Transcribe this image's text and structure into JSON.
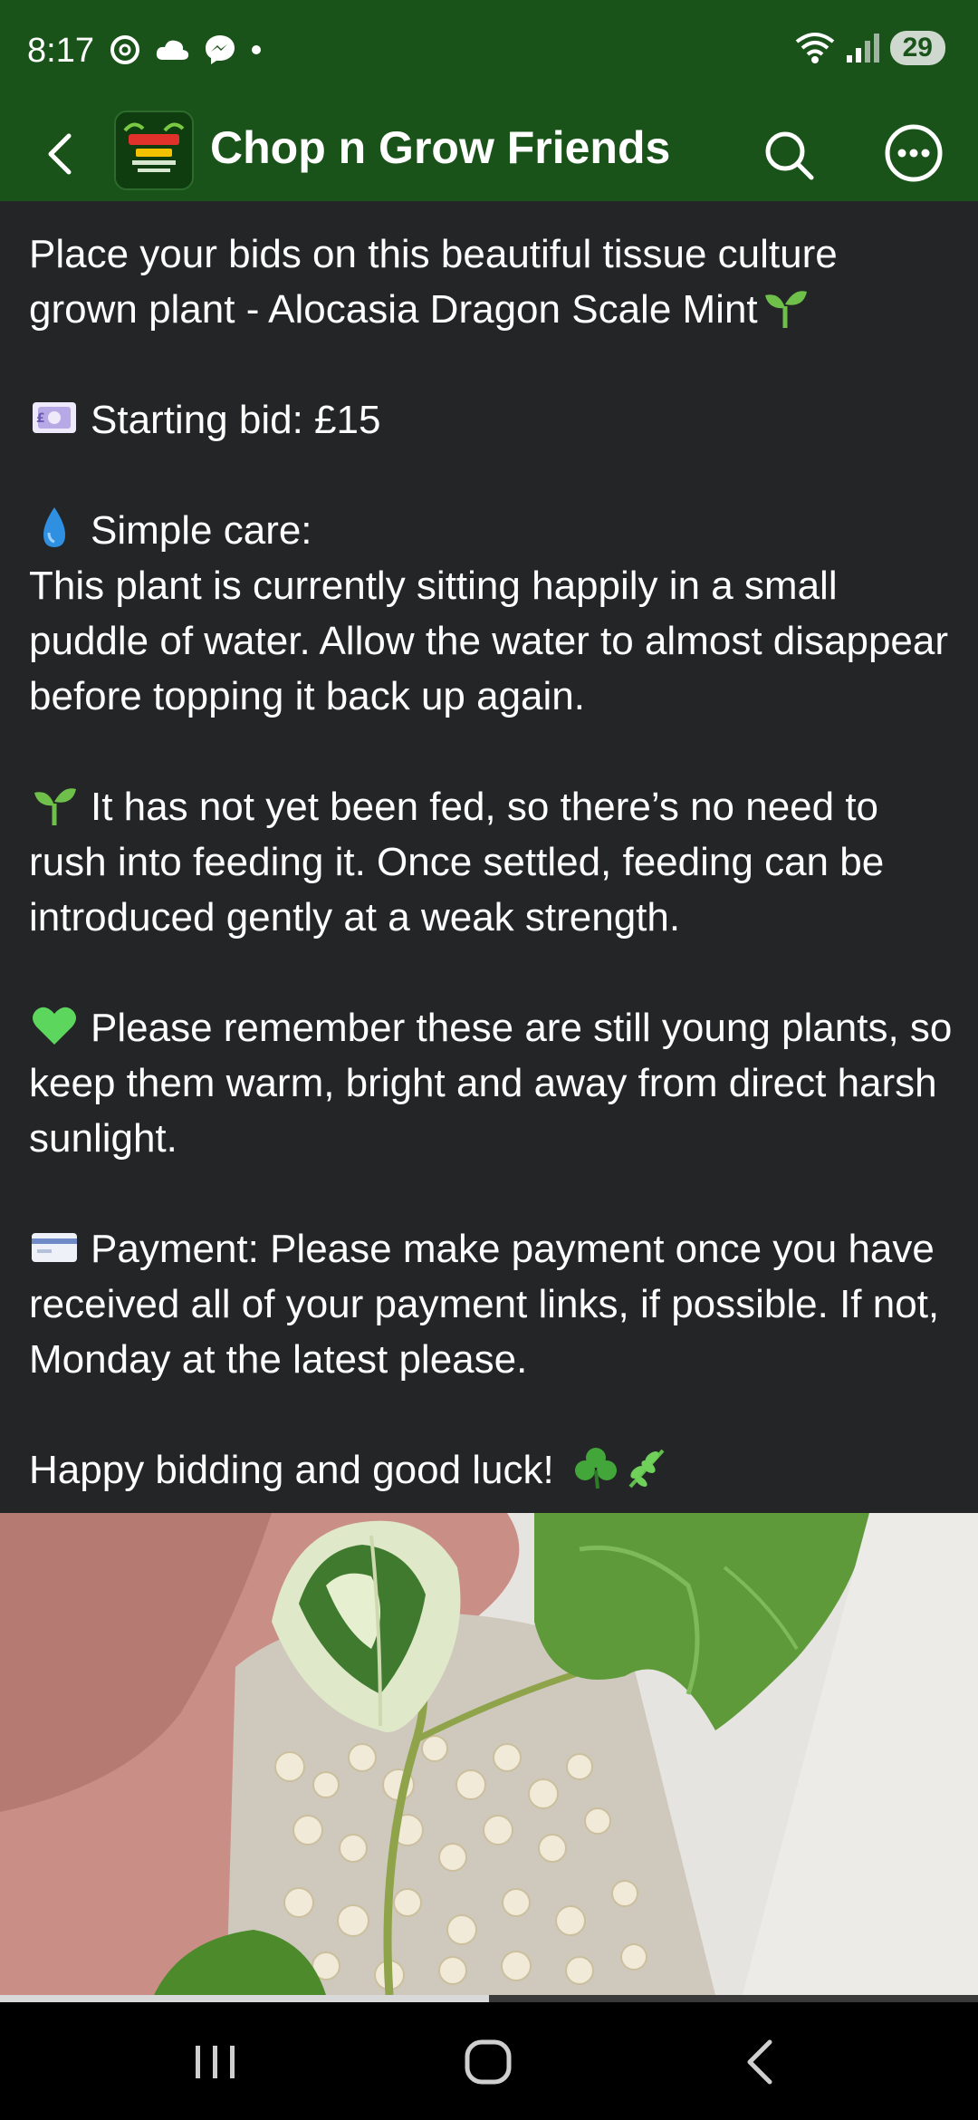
{
  "status_bar": {
    "time": "8:17",
    "battery": "29"
  },
  "app_bar": {
    "title": "Chop n Grow Friends",
    "avatar_text": "Chop n Grow Friends"
  },
  "post": {
    "intro": "Place your bids on this beautiful tissue culture grown plant - Alocasia Dragon Scale Mint",
    "starting_bid": "Starting bid: £15",
    "care_heading": "Simple care:",
    "care_text": "This plant is currently sitting happily in a small puddle of water. Allow the water to almost disappear before topping it back up again.",
    "feeding": "It has not yet been fed, so there’s no need to rush into feeding it. Once settled, feeding can be introduced gently at a weak strength.",
    "reminder": "Please remember these are still young plants, so keep them warm, bright and away from direct harsh sunlight.",
    "payment": "Payment: Please make payment once you have received all of your payment links, if possible. If not, Monday at the latest please.",
    "closing": "Happy bidding and good luck!"
  },
  "media": {
    "progress": 0.5
  },
  "colors": {
    "header_green": "#1a5319",
    "background": "#242526",
    "text": "#ffffff"
  },
  "icons": [
    "back-arrow-icon",
    "search-icon",
    "more-options-icon",
    "seedling-icon",
    "money-icon",
    "droplet-icon",
    "green-heart-icon",
    "credit-card-icon",
    "shamrock-icon",
    "herb-icon"
  ]
}
